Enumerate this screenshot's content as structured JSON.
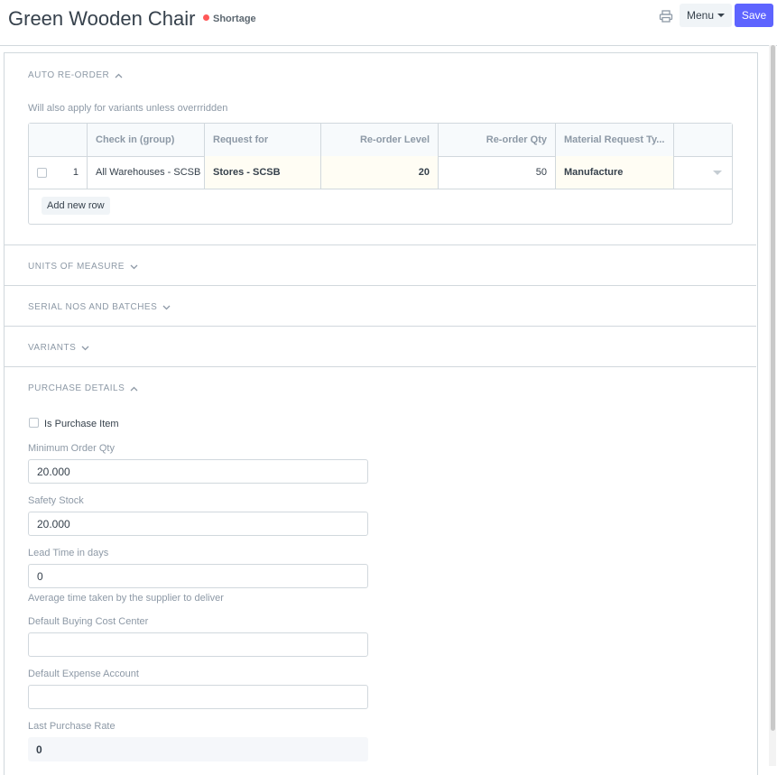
{
  "header": {
    "title": "Green Wooden Chair",
    "status": "Shortage",
    "status_color": "#ff5858",
    "menu_label": "Menu",
    "save_label": "Save",
    "accent_color": "#5e64ff"
  },
  "sections": {
    "auto_reorder": "AUTO RE-ORDER",
    "units_of_measure": "UNITS OF MEASURE",
    "serial_nos": "SERIAL NOS AND BATCHES",
    "variants": "VARIANTS",
    "purchase_details": "PURCHASE DETAILS"
  },
  "auto_reorder": {
    "note": "Will also apply for variants unless overrridden",
    "columns": [
      "Check in (group)",
      "Request for",
      "Re-order Level",
      "Re-order Qty",
      "Material Request Ty..."
    ],
    "rows": [
      {
        "index": "1",
        "check_in_group": "All Warehouses - SCSB",
        "request_for": "Stores - SCSB",
        "reorder_level": "20",
        "reorder_qty": "50",
        "material_request_type": "Manufacture"
      }
    ],
    "add_row_label": "Add new row"
  },
  "purchase": {
    "is_purchase_item_label": "Is Purchase Item",
    "min_order_qty_label": "Minimum Order Qty",
    "min_order_qty_value": "20.000",
    "safety_stock_label": "Safety Stock",
    "safety_stock_value": "20.000",
    "lead_time_label": "Lead Time in days",
    "lead_time_value": "0",
    "lead_time_help": "Average time taken by the supplier to deliver",
    "buying_cost_center_label": "Default Buying Cost Center",
    "buying_cost_center_value": "",
    "expense_account_label": "Default Expense Account",
    "expense_account_value": "",
    "last_purchase_rate_label": "Last Purchase Rate",
    "last_purchase_rate_value": "0"
  }
}
